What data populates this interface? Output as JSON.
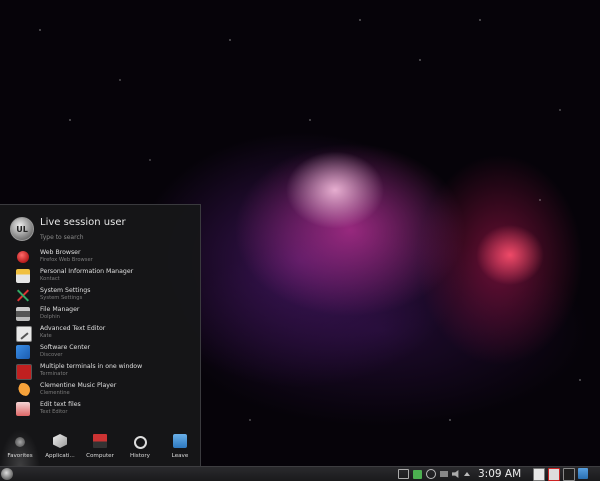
{
  "launcher": {
    "user_name": "Live session user",
    "search_placeholder": "Type to search",
    "avatar_text": "UL",
    "favorites": [
      {
        "title": "Web Browser",
        "subtitle": "Firefox Web Browser",
        "icon": "web-browser-icon"
      },
      {
        "title": "Personal Information Manager",
        "subtitle": "Kontact",
        "icon": "pim-icon"
      },
      {
        "title": "System Settings",
        "subtitle": "System Settings",
        "icon": "system-settings-icon"
      },
      {
        "title": "File Manager",
        "subtitle": "Dolphin",
        "icon": "file-manager-icon"
      },
      {
        "title": "Advanced Text Editor",
        "subtitle": "Kate",
        "icon": "text-editor-icon"
      },
      {
        "title": "Software Center",
        "subtitle": "Discover",
        "icon": "software-center-icon"
      },
      {
        "title": "Multiple terminals in one window",
        "subtitle": "Terminator",
        "icon": "terminal-icon"
      },
      {
        "title": "Clementine Music Player",
        "subtitle": "Clementine",
        "icon": "music-player-icon"
      },
      {
        "title": "Edit text files",
        "subtitle": "Text Editor",
        "icon": "edit-text-icon"
      }
    ],
    "tabs": [
      {
        "label": "Favorites",
        "icon": "favorites-icon",
        "active": true
      },
      {
        "label": "Applicati...",
        "icon": "applications-icon",
        "active": false
      },
      {
        "label": "Computer",
        "icon": "computer-icon",
        "active": false
      },
      {
        "label": "History",
        "icon": "history-icon",
        "active": false
      },
      {
        "label": "Leave",
        "icon": "leave-icon",
        "active": false
      }
    ]
  },
  "panel": {
    "clock": "3:09 AM"
  }
}
